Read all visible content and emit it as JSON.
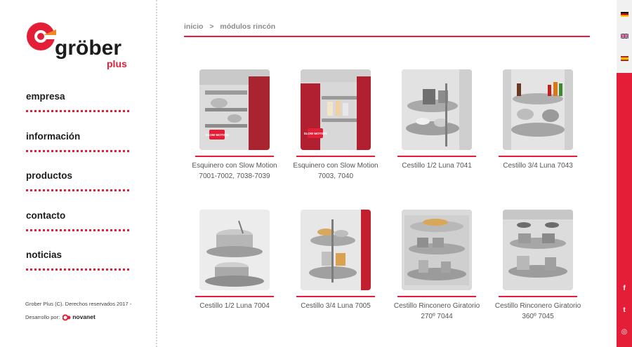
{
  "brand": {
    "name": "gröber",
    "sub": "plus",
    "colors": {
      "accent": "#e31e36",
      "text": "#1c1c1c"
    }
  },
  "nav": [
    {
      "id": "empresa",
      "label": "empresa"
    },
    {
      "id": "informacion",
      "label": "información"
    },
    {
      "id": "productos",
      "label": "productos"
    },
    {
      "id": "contacto",
      "label": "contacto"
    },
    {
      "id": "noticias",
      "label": "noticias"
    }
  ],
  "footer": {
    "copyright": "Grober Plus (C). Derechos reservados 2017 -",
    "developed_by": "Desarrollo por:",
    "developer": "novanet"
  },
  "breadcrumb": {
    "home": "inicio",
    "separator": ">",
    "current": "módulos rincón"
  },
  "products": [
    {
      "title": "Esquinero con Slow Motion 7001-7002, 7038-7039",
      "badge": "SLOW MOTION"
    },
    {
      "title": "Esquinero con Slow Motion 7003, 7040",
      "badge": "SLOW MOTION"
    },
    {
      "title": "Cestillo 1/2 Luna 7041"
    },
    {
      "title": "Cestillo 3/4 Luna 7043"
    },
    {
      "title": "Cestillo 1/2 Luna 7004"
    },
    {
      "title": "Cestillo 3/4 Luna 7005"
    },
    {
      "title": "Cestillo Rinconero Giratorio 270º 7044"
    },
    {
      "title": "Cestillo Rinconero Giratorio 360º 7045"
    }
  ],
  "languages": [
    {
      "code": "de",
      "icon": "german-flag-icon"
    },
    {
      "code": "en",
      "icon": "uk-flag-icon"
    },
    {
      "code": "es",
      "icon": "spanish-flag-icon"
    }
  ],
  "social": [
    {
      "name": "facebook",
      "icon": "facebook-icon",
      "glyph": "f"
    },
    {
      "name": "twitter",
      "icon": "twitter-icon",
      "glyph": "t"
    },
    {
      "name": "instagram",
      "icon": "instagram-icon",
      "glyph": "◎"
    }
  ]
}
